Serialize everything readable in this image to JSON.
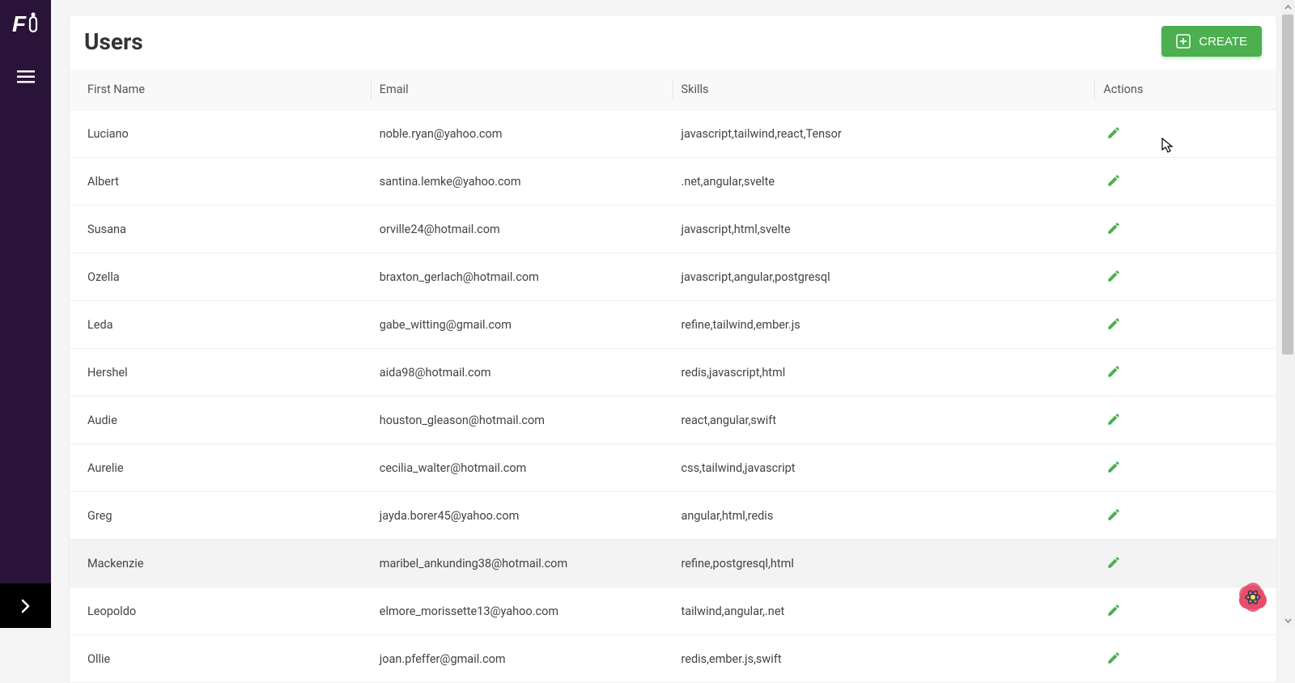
{
  "page": {
    "title": "Users"
  },
  "buttons": {
    "create": "CREATE"
  },
  "table": {
    "columns": {
      "firstName": "First Name",
      "email": "Email",
      "skills": "Skills",
      "actions": "Actions"
    },
    "rows": [
      {
        "firstName": "Luciano",
        "email": "noble.ryan@yahoo.com",
        "skills": "javascript,tailwind,react,Tensor"
      },
      {
        "firstName": "Albert",
        "email": "santina.lemke@yahoo.com",
        "skills": ".net,angular,svelte"
      },
      {
        "firstName": "Susana",
        "email": "orville24@hotmail.com",
        "skills": "javascript,html,svelte"
      },
      {
        "firstName": "Ozella",
        "email": "braxton_gerlach@hotmail.com",
        "skills": "javascript,angular,postgresql"
      },
      {
        "firstName": "Leda",
        "email": "gabe_witting@gmail.com",
        "skills": "refine,tailwind,ember.js"
      },
      {
        "firstName": "Hershel",
        "email": "aida98@hotmail.com",
        "skills": "redis,javascript,html"
      },
      {
        "firstName": "Audie",
        "email": "houston_gleason@hotmail.com",
        "skills": "react,angular,swift"
      },
      {
        "firstName": "Aurelie",
        "email": "cecilia_walter@hotmail.com",
        "skills": "css,tailwind,javascript"
      },
      {
        "firstName": "Greg",
        "email": "jayda.borer45@yahoo.com",
        "skills": "angular,html,redis"
      },
      {
        "firstName": "Mackenzie",
        "email": "maribel_ankunding38@hotmail.com",
        "skills": "refine,postgresql,html"
      },
      {
        "firstName": "Leopoldo",
        "email": "elmore_morissette13@yahoo.com",
        "skills": "tailwind,angular,.net"
      },
      {
        "firstName": "Ollie",
        "email": "joan.pfeffer@gmail.com",
        "skills": "redis,ember.js,swift"
      }
    ],
    "hoveredRowIndex": 9
  },
  "icons": {
    "edit": "edit-icon"
  }
}
